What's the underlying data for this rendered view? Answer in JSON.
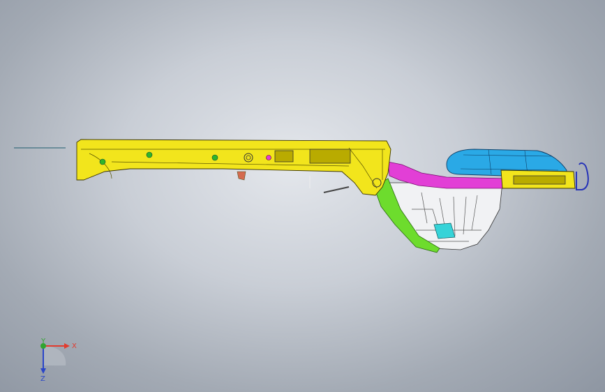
{
  "viewport": {
    "background_top": "#e4e7ec",
    "background_bottom": "#8e96a2"
  },
  "model": {
    "colors": {
      "frame_rail": "#f2e51c",
      "frame_rail_dark": "#b9ab00",
      "fuel_tank": "#2aa9e6",
      "fuel_tank_dark": "#1577b4",
      "crossmember_magenta": "#e23fd6",
      "floor_white": "#f1f2f4",
      "liner_green": "#6ddc2d",
      "bracket_cyan": "#36d3d8",
      "hook_blue": "#2633b8",
      "fastener_green": "#2fb52a",
      "bracket_salmon": "#d46a4e",
      "outline": "#222222"
    }
  },
  "triad": {
    "x_label": "X",
    "y_label": "Y",
    "z_label": "Z",
    "x_color": "#e23b2e",
    "y_color": "#2fa52f",
    "z_color": "#2a45c8"
  }
}
